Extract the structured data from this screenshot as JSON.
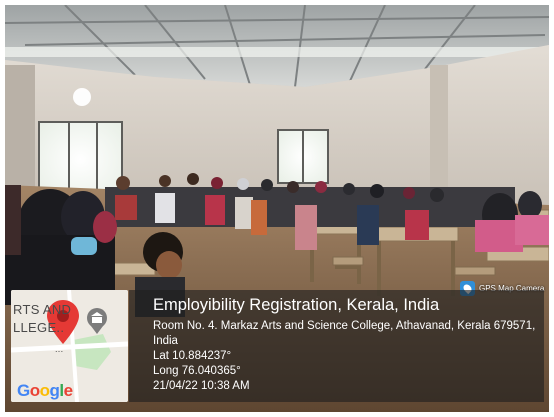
{
  "overlay": {
    "app_badge": "GPS Map Camera",
    "title": "Employibility Registration, Kerala, India",
    "address_line1": "Room No. 4. Markaz Arts and Science College, Athavanad, Kerala 679571,",
    "address_line2": "India",
    "latitude": "Lat 10.884237°",
    "longitude": "Long 76.040365°",
    "timestamp": "21/04/22 10:38 AM"
  },
  "map": {
    "label_line1": "RTS AND",
    "label_line2": "LLEGE..",
    "label_line3": "...",
    "provider": "Google",
    "provider_letters": [
      "G",
      "o",
      "o",
      "g",
      "l",
      "e"
    ],
    "provider_colors": [
      "#4285F4",
      "#EA4335",
      "#FBBC05",
      "#4285F4",
      "#34A853",
      "#EA4335"
    ],
    "pin_color": "#e53935",
    "icon_names": [
      "map-pin-icon",
      "place-marker-icon"
    ]
  },
  "colors": {
    "wall": "#d9d3cb",
    "roof": "#bfc3c4",
    "floor": "#8a6a4c",
    "gps_badge": "#2f8fd8"
  }
}
